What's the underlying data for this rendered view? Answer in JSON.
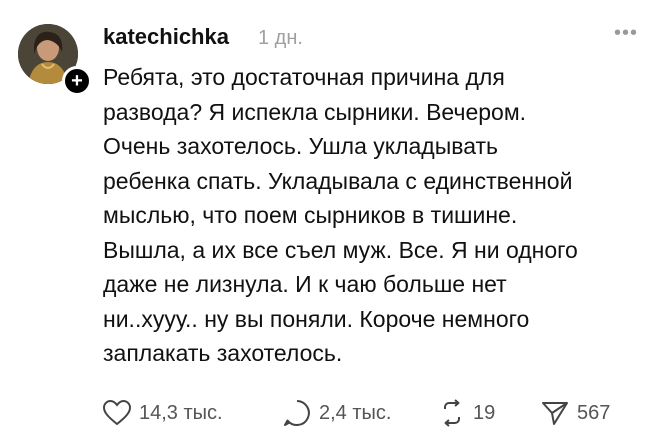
{
  "post": {
    "username": "katechichka",
    "timestamp": "1 дн.",
    "more_icon": "more-dots-icon",
    "lines": [
      "Ребята, это достаточная причина для",
      "развода? Я испекла сырники. Вечером.",
      "Очень захотелось. Ушла укладывать",
      "ребенка спать. Укладывала с единственной",
      "мыслью, что поем сырников в тишине.",
      "Вышла, а их все съел муж. Все. Я ни одного",
      "даже не лизнула. И к чаю больше нет",
      "ни..хууу.. ну вы поняли. Короче немного",
      "заплакать захотелось."
    ]
  },
  "actions": {
    "likes": "14,3 тыс.",
    "comments": "2,4 тыс.",
    "reposts": "19",
    "shares": "567"
  }
}
